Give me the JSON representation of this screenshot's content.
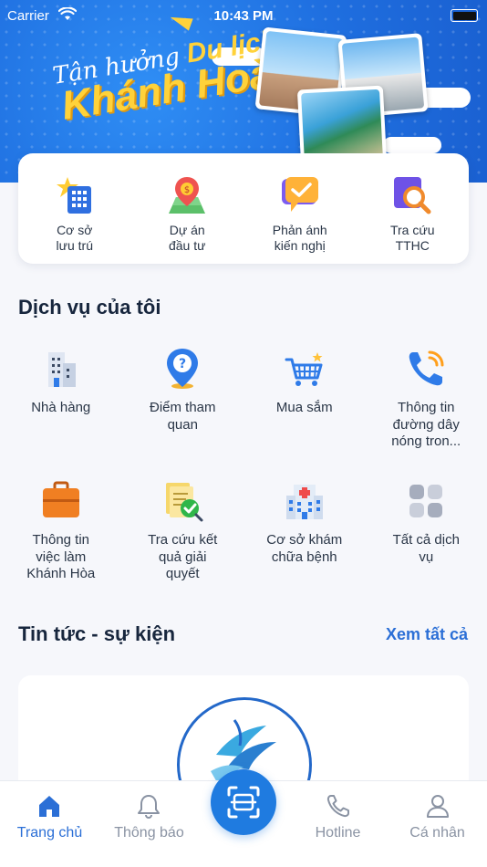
{
  "status_bar": {
    "carrier": "Carrier",
    "time": "10:43 PM"
  },
  "banner": {
    "line1_a": "Tận hưởng",
    "line1_b": "Du lịch",
    "line2": "Khánh Hoà"
  },
  "quick_actions": [
    {
      "label": "Cơ sở\nlưu trú",
      "icon": "hotel-building-icon"
    },
    {
      "label": "Dự án\nđầu tư",
      "icon": "map-pin-investment-icon"
    },
    {
      "label": "Phản ánh\nkiến nghị",
      "icon": "feedback-chat-icon"
    },
    {
      "label": "Tra cứu\nTTHC",
      "icon": "search-document-icon"
    }
  ],
  "services": {
    "title": "Dịch vụ của tôi",
    "items": [
      {
        "label": "Nhà hàng",
        "icon": "restaurant-building-icon"
      },
      {
        "label": "Điểm tham\nquan",
        "icon": "location-help-icon"
      },
      {
        "label": "Mua sắm",
        "icon": "shopping-cart-icon"
      },
      {
        "label": "Thông tin\nđường dây\nnóng tron...",
        "icon": "phone-hotline-icon"
      },
      {
        "label": "Thông tin\nviệc làm\nKhánh Hòa",
        "icon": "briefcase-icon"
      },
      {
        "label": "Tra cứu kết\nquả giải\nquyết",
        "icon": "document-check-icon"
      },
      {
        "label": "Cơ sở khám\nchữa bệnh",
        "icon": "hospital-icon"
      },
      {
        "label": "Tất cả dịch\nvụ",
        "icon": "grid-apps-icon"
      }
    ]
  },
  "news": {
    "title": "Tin tức - sự kiện",
    "see_all": "Xem tất cả"
  },
  "tabbar": {
    "tabs": [
      {
        "label": "Trang chủ",
        "icon": "home-icon",
        "active": true
      },
      {
        "label": "Thông báo",
        "icon": "bell-icon",
        "active": false
      },
      {
        "label": "Hotline",
        "icon": "phone-icon",
        "active": false
      },
      {
        "label": "Cá nhân",
        "icon": "user-icon",
        "active": false
      }
    ],
    "center": {
      "icon": "scan-qr-icon"
    }
  },
  "colors": {
    "primary": "#2b6fd6",
    "banner": "#1f6fe0",
    "accent": "#ffd23a"
  }
}
